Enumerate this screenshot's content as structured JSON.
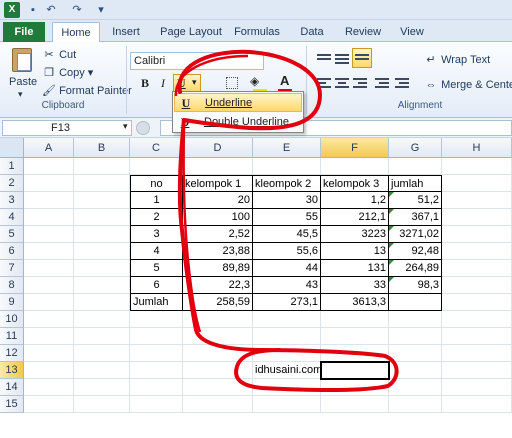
{
  "titlebar": {
    "logo": "X",
    "save_icon": "save-icon",
    "undo": "↶",
    "redo": "↷",
    "customize": "▾"
  },
  "tabs": [
    "File",
    "Home",
    "Insert",
    "Page Layout",
    "Formulas",
    "Data",
    "Review",
    "View"
  ],
  "ribbon": {
    "clipboard": {
      "paste": "Paste",
      "cut": "Cut",
      "copy": "Copy",
      "format_painter": "Format Painter",
      "label": "Clipboard"
    },
    "font": {
      "name": "Calibri",
      "bold": "B",
      "italic": "I",
      "underline": "U",
      "font_color_letter": "A"
    },
    "alignment": {
      "wrap_text": "Wrap Text",
      "merge_center": "Merge & Center",
      "label": "Alignment"
    }
  },
  "underline_menu": {
    "items": [
      {
        "icon": "U",
        "label": "Underline"
      },
      {
        "icon": "D",
        "label": "Double Underline"
      }
    ]
  },
  "formula_bar": {
    "name_box": "F13"
  },
  "columns": [
    "A",
    "B",
    "C",
    "D",
    "E",
    "F",
    "G",
    "H"
  ],
  "rows": [
    "1",
    "2",
    "3",
    "4",
    "5",
    "6",
    "7",
    "8",
    "9",
    "10",
    "11",
    "12",
    "13",
    "14",
    "15"
  ],
  "table": {
    "headers": [
      "no",
      "kelompok 1",
      "kleompok 2",
      "kelompok 3",
      "jumlah"
    ],
    "rows": [
      [
        "1",
        "20",
        "30",
        "1,2",
        "51,2"
      ],
      [
        "2",
        "100",
        "55",
        "212,1",
        "367,1"
      ],
      [
        "3",
        "2,52",
        "45,5",
        "3223",
        "3271,02"
      ],
      [
        "4",
        "23,88",
        "55,6",
        "13",
        "92,48"
      ],
      [
        "5",
        "89,89",
        "44",
        "131",
        "264,89"
      ],
      [
        "6",
        "22,3",
        "43",
        "33",
        "98,3"
      ]
    ],
    "total": [
      "Jumlah",
      "258,59",
      "273,1",
      "3613,3",
      ""
    ]
  },
  "e13_text": "idhusaini.com",
  "colors": {
    "file_tab": "#1f7a3b",
    "selected_header": "#f3c94f",
    "annotation": "#e0000f",
    "menu_highlight": "#ffd86b"
  }
}
